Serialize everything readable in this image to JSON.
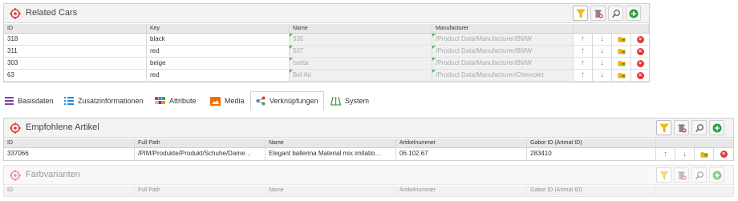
{
  "related_cars": {
    "title": "Related Cars",
    "columns": [
      "ID",
      "Key",
      "Name",
      "Manufacturer"
    ],
    "rows": [
      {
        "id": "318",
        "key": "black",
        "name": "335",
        "manufacturer": "/Product Data/Manufacturer/BMW"
      },
      {
        "id": "311",
        "key": "red",
        "name": "507",
        "manufacturer": "/Product Data/Manufacturer/BMW"
      },
      {
        "id": "303",
        "key": "beige",
        "name": "Isetta",
        "manufacturer": "/Product Data/Manufacturer/BMW"
      },
      {
        "id": "63",
        "key": "red",
        "name": "Bel Air",
        "manufacturer": "/Product Data/Manufacturer/Chevrolet"
      }
    ]
  },
  "tabs": [
    {
      "label": "Basisdaten"
    },
    {
      "label": "Zusatzinformationen"
    },
    {
      "label": "Attribute"
    },
    {
      "label": "Media"
    },
    {
      "label": "Verknüpfungen"
    },
    {
      "label": "System"
    }
  ],
  "empfohlene": {
    "title": "Empfohlene Artikel",
    "columns": [
      "ID",
      "Full Path",
      "Name",
      "Artikelnummer",
      "Gabor ID (Artmat ID)"
    ],
    "rows": [
      {
        "id": "337066",
        "path": "/PIM/Produkte/Produkt/Schuhe/Dame…",
        "name": "Elegant ballerina Material mix imitatio…",
        "artikelnummer": "06.102.67",
        "gabor": "283410"
      }
    ]
  },
  "farbvarianten": {
    "title": "Farbvarianten",
    "columns": [
      "ID",
      "Full Path",
      "Name",
      "Artikelnummer",
      "Gabor ID (Artmat ID)"
    ]
  },
  "colors": {
    "target_red": "#e53935",
    "filter_yellow": "#f5c400",
    "add_green": "#2e9e3e",
    "delete_red": "#e53935"
  }
}
